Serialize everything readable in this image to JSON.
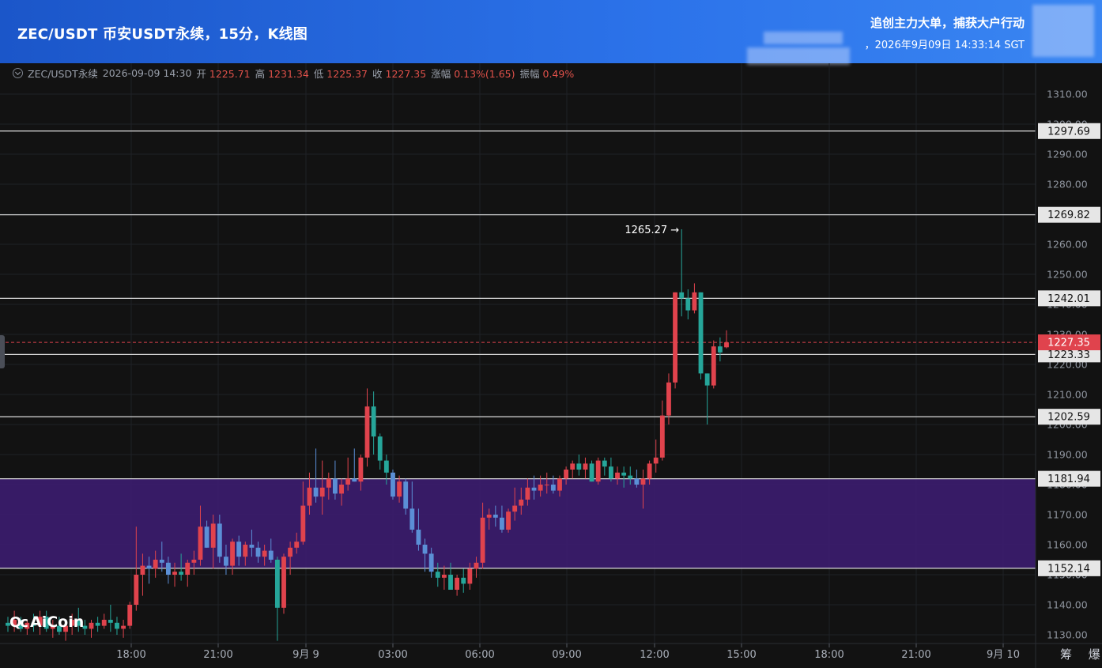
{
  "header": {
    "title": "ZEC/USDT 币安USDT永续，15分，K线图",
    "headline": "追创主力大单，捕获大户行动",
    "timestamp": "，2026年9月09日 14:33:14 SGT"
  },
  "ohlc_bar": {
    "symbol": "ZEC/USDT永续",
    "time": "2026-09-09 14:30",
    "open_label": "开",
    "open": "1225.71",
    "high_label": "高",
    "high": "1231.34",
    "low_label": "低",
    "low": "1225.37",
    "close_label": "收",
    "close": "1227.35",
    "change_label": "涨幅",
    "change": "0.13%(1.65)",
    "amplitude_label": "振幅",
    "amplitude": "0.49%"
  },
  "logo": {
    "text": "AiCoin",
    "mark": "Qc"
  },
  "corner_label": "筹 爆",
  "colors": {
    "up": "#e0434d",
    "down": "#26a69a",
    "down_zone": "#5b8fd6",
    "zone_fill": "#3a1c6c",
    "line": "#d9d9d9",
    "current_price": "#e0434d",
    "background": "#121212"
  },
  "chart_data": {
    "type": "candlestick",
    "interval": "15分",
    "ylim": [
      1127,
      1315
    ],
    "y_ticks": [
      "1130.00",
      "1140.00",
      "1150.00",
      "1160.00",
      "1170.00",
      "1180.00",
      "1190.00",
      "1200.00",
      "1210.00",
      "1220.00",
      "1230.00",
      "1240.00",
      "1250.00",
      "1260.00",
      "1270.00",
      "1280.00",
      "1290.00",
      "1300.00",
      "1310.00"
    ],
    "x_ticks": [
      "18:00",
      "21:00",
      "9月 9",
      "03:00",
      "06:00",
      "09:00",
      "12:00",
      "15:00",
      "18:00",
      "21:00",
      "9月 10"
    ],
    "horizontal_lines": [
      "1297.69",
      "1269.82",
      "1242.01",
      "1223.33",
      "1202.59",
      "1181.94",
      "1152.14"
    ],
    "zone": {
      "from": 1152.14,
      "to": 1181.94
    },
    "current_price": "1227.35",
    "high_annotation": "1265.27 →",
    "candles": [
      [
        1134,
        1136,
        1131,
        1133
      ],
      [
        1133,
        1138,
        1131,
        1135
      ],
      [
        1135,
        1136,
        1131,
        1132
      ],
      [
        1132,
        1135,
        1130,
        1134
      ],
      [
        1134,
        1137,
        1131,
        1133
      ],
      [
        1133,
        1138,
        1130,
        1136
      ],
      [
        1136,
        1138,
        1131,
        1132
      ],
      [
        1132,
        1135,
        1129,
        1133
      ],
      [
        1133,
        1136,
        1130,
        1131
      ],
      [
        1131,
        1134,
        1128,
        1133
      ],
      [
        1133,
        1137,
        1130,
        1135
      ],
      [
        1135,
        1139,
        1131,
        1133
      ],
      [
        1133,
        1135,
        1130,
        1132
      ],
      [
        1132,
        1135,
        1129,
        1134
      ],
      [
        1134,
        1136,
        1131,
        1133
      ],
      [
        1133,
        1137,
        1132,
        1135
      ],
      [
        1135,
        1140,
        1131,
        1134
      ],
      [
        1134,
        1136,
        1130,
        1132
      ],
      [
        1132,
        1135,
        1129,
        1133
      ],
      [
        1133,
        1141,
        1132,
        1140
      ],
      [
        1140,
        1166,
        1138,
        1150
      ],
      [
        1150,
        1157,
        1143,
        1153
      ],
      [
        1153,
        1156,
        1147,
        1152
      ],
      [
        1152,
        1158,
        1149,
        1155
      ],
      [
        1155,
        1161,
        1151,
        1154
      ],
      [
        1154,
        1156,
        1147,
        1150
      ],
      [
        1150,
        1154,
        1146,
        1151
      ],
      [
        1151,
        1157,
        1148,
        1150
      ],
      [
        1150,
        1155,
        1146,
        1154
      ],
      [
        1154,
        1158,
        1150,
        1155
      ],
      [
        1155,
        1173,
        1153,
        1166
      ],
      [
        1166,
        1168,
        1159,
        1159
      ],
      [
        1159,
        1170,
        1152,
        1167
      ],
      [
        1167,
        1170,
        1154,
        1156
      ],
      [
        1156,
        1160,
        1150,
        1153
      ],
      [
        1153,
        1162,
        1150,
        1161
      ],
      [
        1161,
        1163,
        1153,
        1156
      ],
      [
        1156,
        1161,
        1153,
        1160
      ],
      [
        1160,
        1165,
        1156,
        1159
      ],
      [
        1159,
        1161,
        1154,
        1156
      ],
      [
        1156,
        1160,
        1153,
        1158
      ],
      [
        1158,
        1162,
        1154,
        1155
      ],
      [
        1155,
        1156,
        1128,
        1139
      ],
      [
        1139,
        1157,
        1137,
        1156
      ],
      [
        1156,
        1161,
        1150,
        1159
      ],
      [
        1159,
        1164,
        1157,
        1161
      ],
      [
        1161,
        1181,
        1160,
        1173
      ],
      [
        1173,
        1184,
        1170,
        1179
      ],
      [
        1179,
        1192,
        1174,
        1176
      ],
      [
        1176,
        1188,
        1170,
        1179
      ],
      [
        1179,
        1184,
        1175,
        1182
      ],
      [
        1182,
        1188,
        1175,
        1177
      ],
      [
        1177,
        1182,
        1173,
        1180
      ],
      [
        1180,
        1189,
        1178,
        1182
      ],
      [
        1182,
        1192,
        1181,
        1181
      ],
      [
        1181,
        1190,
        1178,
        1189
      ],
      [
        1189,
        1212,
        1186,
        1206
      ],
      [
        1206,
        1211,
        1190,
        1196
      ],
      [
        1196,
        1197,
        1185,
        1188
      ],
      [
        1188,
        1190,
        1180,
        1184
      ],
      [
        1184,
        1185,
        1175,
        1176
      ],
      [
        1176,
        1183,
        1174,
        1181
      ],
      [
        1181,
        1182,
        1170,
        1172
      ],
      [
        1172,
        1181,
        1164,
        1165
      ],
      [
        1165,
        1172,
        1158,
        1160
      ],
      [
        1160,
        1162,
        1151,
        1157
      ],
      [
        1157,
        1159,
        1149,
        1151
      ],
      [
        1151,
        1154,
        1146,
        1149
      ],
      [
        1149,
        1153,
        1145,
        1150
      ],
      [
        1150,
        1154,
        1145,
        1145
      ],
      [
        1145,
        1150,
        1143,
        1149
      ],
      [
        1149,
        1152,
        1144,
        1147
      ],
      [
        1147,
        1154,
        1145,
        1152
      ],
      [
        1152,
        1156,
        1149,
        1154
      ],
      [
        1154,
        1174,
        1152,
        1169
      ],
      [
        1169,
        1172,
        1165,
        1170
      ],
      [
        1170,
        1173,
        1166,
        1169
      ],
      [
        1169,
        1173,
        1164,
        1165
      ],
      [
        1165,
        1172,
        1164,
        1171
      ],
      [
        1171,
        1179,
        1168,
        1173
      ],
      [
        1173,
        1179,
        1170,
        1175
      ],
      [
        1175,
        1182,
        1173,
        1179
      ],
      [
        1179,
        1183,
        1175,
        1178
      ],
      [
        1178,
        1183,
        1176,
        1180
      ],
      [
        1180,
        1184,
        1177,
        1180
      ],
      [
        1180,
        1183,
        1177,
        1178
      ],
      [
        1178,
        1183,
        1176,
        1182
      ],
      [
        1182,
        1186,
        1180,
        1185
      ],
      [
        1185,
        1188,
        1182,
        1187
      ],
      [
        1187,
        1190,
        1183,
        1185
      ],
      [
        1185,
        1189,
        1182,
        1187
      ],
      [
        1187,
        1188,
        1181,
        1181
      ],
      [
        1181,
        1189,
        1180,
        1188
      ],
      [
        1188,
        1189,
        1183,
        1186
      ],
      [
        1186,
        1189,
        1181,
        1182
      ],
      [
        1182,
        1186,
        1180,
        1184
      ],
      [
        1184,
        1186,
        1179,
        1183
      ],
      [
        1183,
        1186,
        1180,
        1182
      ],
      [
        1182,
        1185,
        1179,
        1180
      ],
      [
        1180,
        1185,
        1172,
        1182
      ],
      [
        1182,
        1188,
        1180,
        1187
      ],
      [
        1187,
        1195,
        1184,
        1189
      ],
      [
        1189,
        1208,
        1188,
        1203
      ],
      [
        1203,
        1217,
        1200,
        1214
      ],
      [
        1214,
        1232,
        1212,
        1244
      ],
      [
        1244,
        1265,
        1236,
        1242
      ],
      [
        1242,
        1245,
        1235,
        1238
      ],
      [
        1238,
        1247,
        1237,
        1244
      ],
      [
        1244,
        1242,
        1215,
        1217
      ],
      [
        1217,
        1212,
        1200,
        1213
      ],
      [
        1213,
        1228,
        1212,
        1226
      ],
      [
        1226,
        1229,
        1221,
        1224
      ],
      [
        1225.71,
        1231.34,
        1225.37,
        1227.35
      ]
    ]
  }
}
